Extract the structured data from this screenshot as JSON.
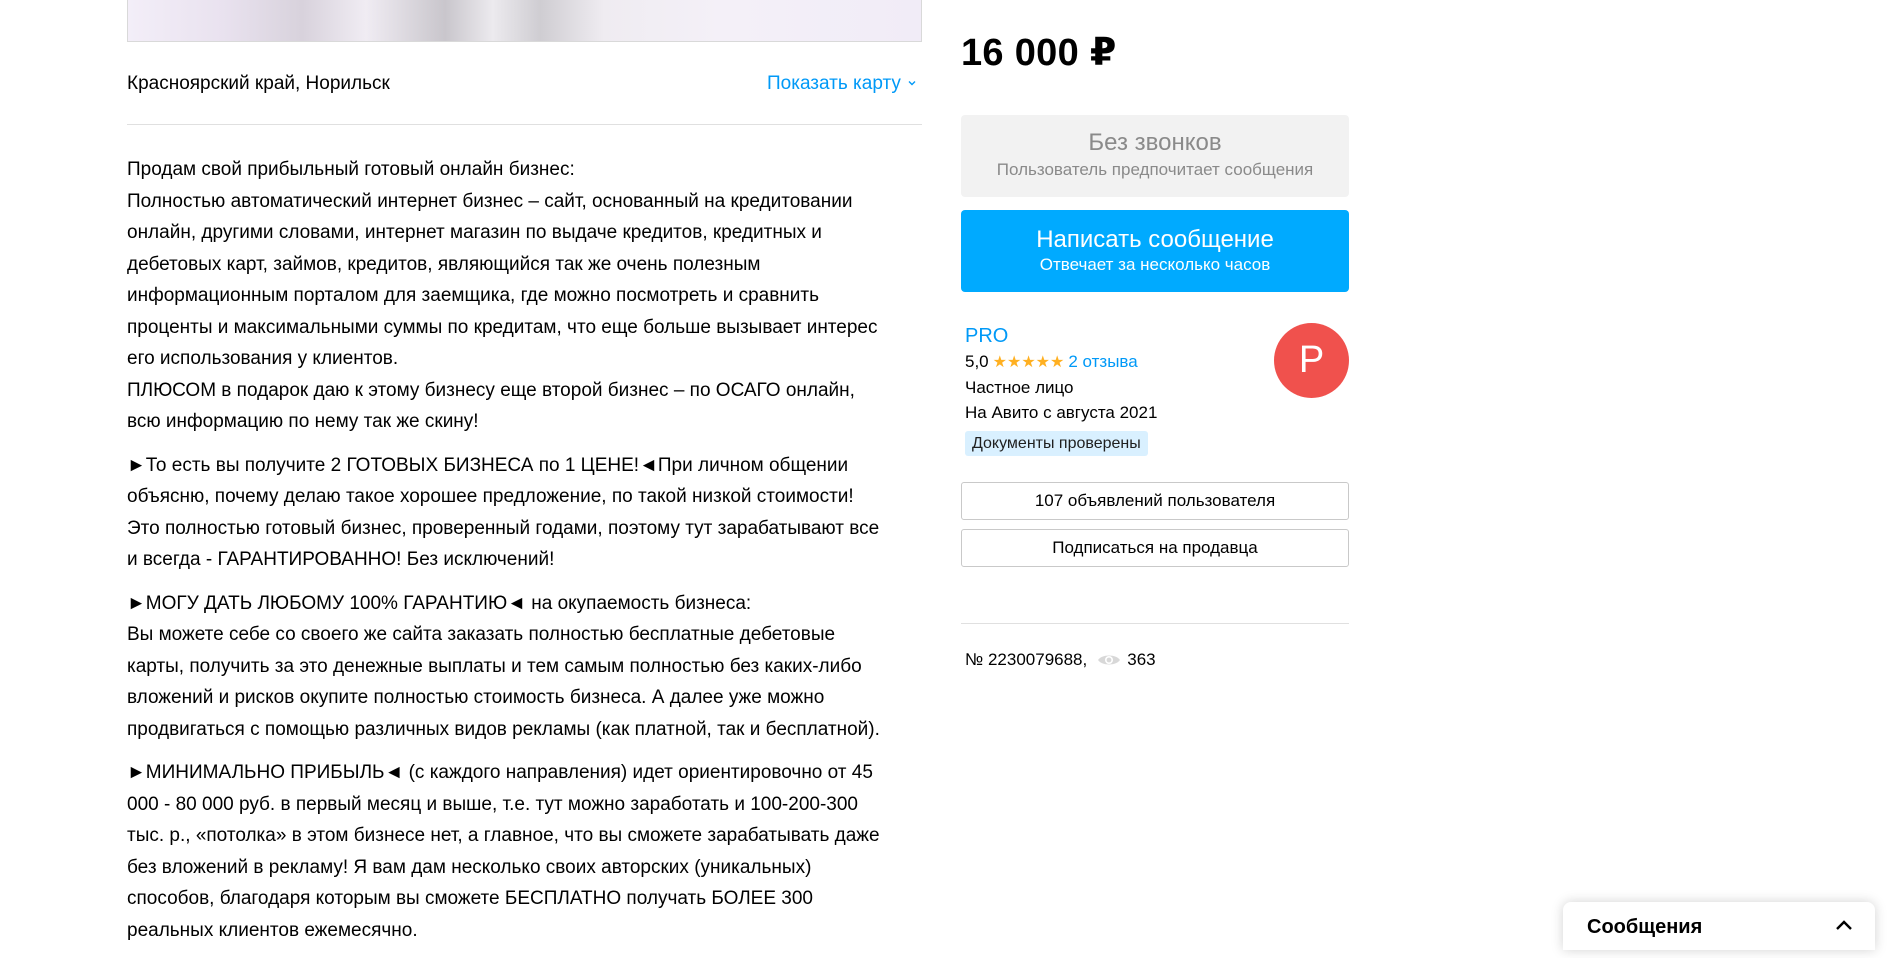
{
  "listing": {
    "location": "Красноярский край, Норильск",
    "show_map_label": "Показать карту",
    "description": [
      "Продам свой прибыльный готовый онлайн бизнес:\nПолностью автоматический интернет бизнес – сайт, основанный на кредитовании\nонлайн, другими словами, интернет магазин по выдаче кредитов, кредитных и\nдебетовых карт, займов, кредитов, являющийся так же очень полезным\nинформационным порталом для заемщика, где можно посмотреть и сравнить\nпроценты и максимальными суммы по кредитам, что еще больше вызывает интерес\nего использования у клиентов.\nПЛЮСОМ в подарок даю к этому бизнесу еще второй бизнес – по ОСАГО онлайн,\nвсю информацию по нему так же скину!",
      "►То есть вы получите 2 ГОТОВЫХ БИЗНЕСА по 1 ЦЕНЕ!◄При личном общении\nобъясню, почему делаю такое хорошее предложение, по такой низкой стоимости!\nЭто полностью готовый бизнес, проверенный годами, поэтому тут зарабатывают все\nи всегда - ГАРАНТИРОВАННО! Без исключений!",
      "►МОГУ ДАТЬ ЛЮБОМУ 100% ГАРАНТИЮ◄ на окупаемость бизнеса:\nВы можете себе со своего же сайта заказать полностью бесплатные дебетовые\nкарты, получить за это денежные выплаты и тем самым полностью без каких-либо\nвложений и рисков окупите полностью стоимость бизнеса. А далее уже можно\nпродвигаться с помощью различных видов рекламы (как платной, так и бесплатной).",
      "►МИНИМАЛЬНО ПРИБЫЛЬ◄ (с каждого направления) идет ориентировочно от 45\n000 - 80 000 руб. в первый месяц и выше, т.е. тут можно заработать и 100-200-300\nтыс. р., «потолка» в этом бизнесе нет, а главное, что вы сможете зарабатывать даже\nбез вложений в рекламу! Я вам дам несколько своих авторских (уникальных)\nспособов, благодаря которым вы сможете БЕСПЛАТНО получать БОЛЕЕ 300\nреальных клиентов ежемесячно."
    ]
  },
  "sidebar": {
    "price": "16 000 ₽",
    "no_calls_title": "Без звонков",
    "no_calls_subtitle": "Пользователь предпочитает сообщения",
    "message_button_title": "Написать сообщение",
    "message_button_subtitle": "Отвечает за несколько часов",
    "seller": {
      "name": "PRO",
      "rating": "5,0",
      "stars": 5,
      "reviews": "2 отзыва",
      "type": "Частное лицо",
      "since": "На Авито с августа 2021",
      "badge": "Документы проверены",
      "avatar_letter": "P",
      "avatar_color": "#f0514d"
    },
    "listings_button": "107 объявлений пользователя",
    "subscribe_button": "Подписаться на продавца",
    "ad_number": "№ 2230079688,",
    "views": "363"
  },
  "messages_panel": {
    "title": "Сообщения"
  },
  "colors": {
    "link": "#0099f7",
    "primary_button": "#00aaff",
    "star": "#ffb021",
    "badge_bg": "#d9f0ff"
  },
  "icons": [
    "chevron-down-icon",
    "star-icon",
    "eye-icon",
    "chevron-up-icon"
  ]
}
